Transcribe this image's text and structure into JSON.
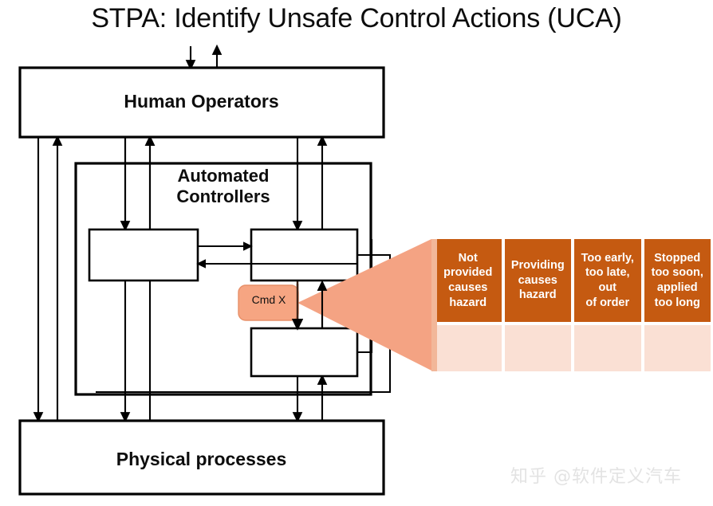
{
  "page": {
    "title": "STPA: Identify Unsafe Control Actions (UCA)",
    "watermark": "知乎 @软件定义汽车"
  },
  "diagram": {
    "boxes": {
      "human_operators": "Human Operators",
      "automated_controllers": "Automated\nControllers",
      "automated_controllers_line1": "Automated",
      "automated_controllers_line2": "Controllers",
      "physical_processes": "Physical processes",
      "controller_a": "",
      "controller_b": "",
      "controller_c": "",
      "command_callout": "Cmd X"
    },
    "colors": {
      "callout_fill": "#f6a582",
      "callout_stroke": "#e08b63",
      "funnel_fill": "#f4a383",
      "box_stroke": "#000000",
      "text": "#0d0d0d"
    }
  },
  "uca_table": {
    "headers": [
      "Not provided causes hazard",
      "Providing causes hazard",
      "Too early, too late, out of order",
      "Stopped too soon, applied too long"
    ],
    "header_lines": [
      [
        "Not",
        "provided",
        "causes",
        "hazard"
      ],
      [
        "Providing",
        "causes",
        "hazard"
      ],
      [
        "Too early,",
        "too late, out",
        "of order"
      ],
      [
        "Stopped",
        "too soon,",
        "applied",
        "too long"
      ]
    ],
    "body_row": [
      "",
      "",
      "",
      ""
    ],
    "colors": {
      "header_bg": "#c55a11",
      "header_text": "#ffffff",
      "body_bg": "#fae0d4",
      "left_strip": "#f2b799"
    }
  }
}
